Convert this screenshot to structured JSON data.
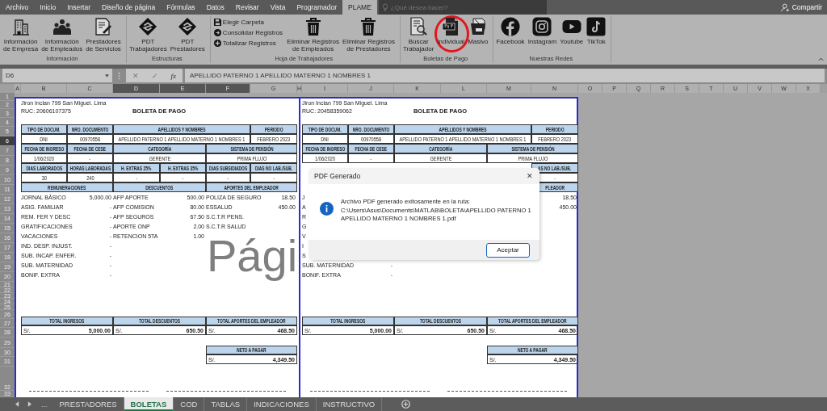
{
  "menu_tabs": [
    {
      "label": "Archivo",
      "selected": false
    },
    {
      "label": "Inicio",
      "selected": false
    },
    {
      "label": "Insertar",
      "selected": false
    },
    {
      "label": "Diseño de página",
      "selected": false
    },
    {
      "label": "Fórmulas",
      "selected": false
    },
    {
      "label": "Datos",
      "selected": false
    },
    {
      "label": "Revisar",
      "selected": false
    },
    {
      "label": "Vista",
      "selected": false
    },
    {
      "label": "Programador",
      "selected": false
    },
    {
      "label": "PLAME",
      "selected": true
    }
  ],
  "search": {
    "placeholder": "¿Qué desea hacer?"
  },
  "share": "Compartir",
  "ribbon_groups": [
    {
      "label": "Información",
      "items": [
        {
          "kind": "large",
          "lines": [
            "Información",
            "de Empresa"
          ]
        },
        {
          "kind": "large",
          "lines": [
            "Información",
            "de Empleados"
          ]
        },
        {
          "kind": "large",
          "lines": [
            "Prestadores",
            "de Servicios"
          ]
        }
      ]
    },
    {
      "label": "Estructuras",
      "items": [
        {
          "kind": "large",
          "lines": [
            "PDT",
            "Trabajadores"
          ]
        },
        {
          "kind": "large",
          "lines": [
            "PDT",
            "Prestadores"
          ]
        }
      ]
    },
    {
      "label": "Hoja de Trabajadores",
      "items": [
        {
          "kind": "stack",
          "entries": [
            "Elegir Carpeta",
            "Consolidar Registros",
            "Totalizar Registros"
          ]
        },
        {
          "kind": "large",
          "lines": [
            "Eliminar Registros",
            "de Empleados"
          ]
        },
        {
          "kind": "large",
          "lines": [
            "Eliminar Registros",
            "de Prestadores"
          ]
        }
      ]
    },
    {
      "label": "Boletas de Pago",
      "items": [
        {
          "kind": "large",
          "lines": [
            "Buscar",
            "Trabajador"
          ],
          "highlighted": false
        },
        {
          "kind": "large",
          "lines": [
            "Individual"
          ],
          "highlighted": true
        },
        {
          "kind": "large",
          "lines": [
            "Masivo"
          ],
          "highlighted": false
        }
      ]
    },
    {
      "label": "Nuestras Redes",
      "items": [
        {
          "kind": "large",
          "lines": [
            "Facebook"
          ]
        },
        {
          "kind": "large",
          "lines": [
            "Instagram"
          ]
        },
        {
          "kind": "large",
          "lines": [
            "Youtube"
          ]
        },
        {
          "kind": "large",
          "lines": [
            "TikTok"
          ]
        }
      ]
    }
  ],
  "formula_bar": {
    "name_box": "D6",
    "cancel": "✕",
    "enter": "✓",
    "fx": "fx",
    "value": "APELLIDO PATERNO 1 APELLIDO MATERNO 1 NOMBRES 1"
  },
  "columns": [
    {
      "label": "A",
      "selected": false
    },
    {
      "label": "B",
      "selected": false
    },
    {
      "label": "C",
      "selected": false
    },
    {
      "label": "D",
      "selected": true
    },
    {
      "label": "E",
      "selected": true
    },
    {
      "label": "F",
      "selected": true
    },
    {
      "label": "G",
      "selected": false
    },
    {
      "label": "H",
      "selected": false
    },
    {
      "label": "I",
      "selected": false
    },
    {
      "label": "J",
      "selected": false
    },
    {
      "label": "K",
      "selected": false
    },
    {
      "label": "L",
      "selected": false
    },
    {
      "label": "M",
      "selected": false
    },
    {
      "label": "N",
      "selected": false
    },
    {
      "label": "O",
      "selected": false
    },
    {
      "label": "P",
      "selected": false
    },
    {
      "label": "Q",
      "selected": false
    },
    {
      "label": "R",
      "selected": false
    },
    {
      "label": "S",
      "selected": false
    },
    {
      "label": "T",
      "selected": false
    },
    {
      "label": "U",
      "selected": false
    },
    {
      "label": "V",
      "selected": false
    },
    {
      "label": "W",
      "selected": false
    },
    {
      "label": "X",
      "selected": false
    }
  ],
  "rows": [
    {
      "label": "1",
      "selected": false
    },
    {
      "label": "2",
      "selected": false
    },
    {
      "label": "3",
      "selected": false
    },
    {
      "label": "4",
      "selected": false
    },
    {
      "label": "5",
      "selected": false
    },
    {
      "label": "6",
      "selected": true
    },
    {
      "label": "7",
      "selected": false
    },
    {
      "label": "8",
      "selected": false
    },
    {
      "label": "9",
      "selected": false
    },
    {
      "label": "10",
      "selected": false
    },
    {
      "label": "11",
      "selected": false
    },
    {
      "label": "12",
      "selected": false
    },
    {
      "label": "13",
      "selected": false
    },
    {
      "label": "14",
      "selected": false
    },
    {
      "label": "15",
      "selected": false
    },
    {
      "label": "16",
      "selected": false
    },
    {
      "label": "17",
      "selected": false
    },
    {
      "label": "18",
      "selected": false
    },
    {
      "label": "19",
      "selected": false
    },
    {
      "label": "20",
      "selected": false
    },
    {
      "label": "21",
      "selected": false
    },
    {
      "label": "22",
      "selected": false
    },
    {
      "label": "23",
      "selected": false
    },
    {
      "label": "24",
      "selected": false
    },
    {
      "label": "25",
      "selected": false
    },
    {
      "label": "26",
      "selected": false
    },
    {
      "label": "27",
      "selected": false
    },
    {
      "label": "28",
      "selected": false
    },
    {
      "label": "29",
      "selected": false
    },
    {
      "label": "30",
      "selected": false
    },
    {
      "label": "31",
      "selected": false
    },
    {
      "label": "32",
      "selected": false
    },
    {
      "label": "33",
      "selected": false
    }
  ],
  "boletas": [
    {
      "address": "Jiron Inclan 799 San Miguel. Lima",
      "ruc": "RUC: 20606107375",
      "title": "BOLETA DE PAGO",
      "table": [
        {
          "kind": "id-head",
          "cells": [
            {
              "text": "TIPO DE DOCUM."
            },
            {
              "text": "NRO. DOCUMENTO"
            },
            {
              "text": "APELLIDOS Y NOMBRES"
            },
            {
              "text": "PERIODO"
            }
          ]
        },
        {
          "kind": "id-value",
          "cells": [
            {
              "text": "DNI"
            },
            {
              "text": "00970558"
            },
            {
              "text": "APELLIDO PATERNO 1 APELLIDO MATERNO 1 NOMBRES 1"
            },
            {
              "text": "FEBRERO 2023"
            }
          ]
        },
        {
          "kind": "date-head",
          "cells": [
            {
              "text": "FECHA DE INGRESO"
            },
            {
              "text": "FECHA DE CESE"
            },
            {
              "text": "CATEGORÍA"
            },
            {
              "text": "SISTEMA DE PENSIÓN"
            }
          ]
        },
        {
          "kind": "date-value",
          "cells": [
            {
              "text": "1/06/2020"
            },
            {
              "text": "-"
            },
            {
              "text": "GERENTE"
            },
            {
              "text": "PRIMA FLUJO"
            }
          ]
        },
        {
          "kind": "count-head",
          "cells": [
            {
              "text": "DIAS LABORADOS"
            },
            {
              "text": "HORAS LABORADAS"
            },
            {
              "text": "H. EXTRAS 25%"
            },
            {
              "text": "H. EXTRAS 35%"
            },
            {
              "text": "DIAS SUBSIDIADOS"
            },
            {
              "text": "DIAS NO LAB./SUB."
            }
          ]
        },
        {
          "kind": "count-value",
          "cells": [
            {
              "text": "30"
            },
            {
              "text": "240"
            },
            {
              "text": "-"
            },
            {
              "text": "-"
            },
            {
              "text": "-"
            },
            {
              "text": "-"
            }
          ]
        },
        {
          "kind": "section-head",
          "cells": [
            {
              "text": "REMUNERACIONES"
            },
            {
              "text": "DESCUENTOS"
            },
            {
              "text": "APORTES DEL EMPLEADOR"
            }
          ]
        }
      ],
      "items": [
        {
          "ingreso": "JORNAL BÁSICO",
          "ingreso_monto": "5,000.00",
          "descuento": "AFP APORTE",
          "descuento_monto": "500.00",
          "aporte": "POLIZA DE SEGURO",
          "aporte_monto": "18.50"
        },
        {
          "ingreso": "ASIG. FAMILIAR",
          "ingreso_monto": "-",
          "descuento": "AFP COMISION",
          "descuento_monto": "80.00",
          "aporte": "ESSALUD",
          "aporte_monto": "450.00"
        },
        {
          "ingreso": "REM. FER Y DESC",
          "ingreso_monto": "-",
          "descuento": "AFP SEGUROS",
          "descuento_monto": "67.50",
          "aporte": "S.C.T.R PENS."
        },
        {
          "ingreso": "GRATIFICACIONES",
          "ingreso_monto": "-",
          "descuento": "APORTE ONP",
          "descuento_monto": "2.00",
          "aporte": "S.C.T.R SALUD"
        },
        {
          "ingreso": "VACACIONES",
          "ingreso_monto": "-",
          "descuento": "RETENCION 5TA",
          "descuento_monto": "1.00"
        },
        {
          "ingreso": "IND. DESP. INJUST.",
          "ingreso_monto": "-"
        },
        {
          "ingreso": "SUB. INCAP. ENFER.",
          "ingreso_monto": "-"
        },
        {
          "ingreso": "SUB. MATERNIDAD",
          "ingreso_monto": "-"
        },
        {
          "ingreso": "BONIF. EXTRA",
          "ingreso_monto": "-"
        }
      ],
      "totals": [
        {
          "head": "TOTAL INGRESOS",
          "currency": "S/.",
          "amount": "5,000.00"
        },
        {
          "head": "TOTAL DESCUENTOS",
          "currency": "S/.",
          "amount": "650.50"
        },
        {
          "head": "TOTAL APORTES DEL EMPLEADOR",
          "currency": "S/.",
          "amount": "468.50"
        }
      ],
      "neto": {
        "head": "NETO A PAGAR",
        "currency": "S/.",
        "amount": "4,349.50"
      }
    },
    {
      "address": "Jiron Inclan 799 San Miguel. Lima",
      "ruc": "RUC: 20458359062",
      "title": "BOLETA DE PAGO",
      "table": [
        {
          "kind": "id-head",
          "cells": [
            {
              "text": "TIPO DE DOCUM."
            },
            {
              "text": "NRO. DOCUMENTO"
            },
            {
              "text": "APELLIDOS Y NOMBRES"
            },
            {
              "text": "PERIODO"
            }
          ]
        },
        {
          "kind": "id-value",
          "cells": [
            {
              "text": "DNI"
            },
            {
              "text": "00970558"
            },
            {
              "text": "APELLIDO PATERNO 1 APELLIDO MATERNO 1 NOMBRES 1"
            },
            {
              "text": "FEBRERO 2023"
            }
          ]
        },
        {
          "kind": "date-head",
          "cells": [
            {
              "text": "FECHA DE INGRESO"
            },
            {
              "text": "FECHA DE CESE"
            },
            {
              "text": "CATEGORÍA"
            },
            {
              "text": "SISTEMA DE PENSIÓN"
            }
          ]
        },
        {
          "kind": "date-value",
          "cells": [
            {
              "text": "1/06/2020"
            },
            {
              "text": "-"
            },
            {
              "text": "GERENTE"
            },
            {
              "text": "PRIMA FLUJO"
            }
          ]
        },
        {
          "kind": "count-head",
          "cells": [
            {},
            {},
            {},
            {},
            {},
            {
              "text": "AS NO LAB./SUB."
            }
          ]
        },
        {
          "kind": "count-value",
          "cells": [
            {},
            {},
            {},
            {},
            {},
            {
              "text": "-"
            }
          ]
        },
        {
          "kind": "count-head",
          "cells": [
            {},
            {},
            {},
            {},
            {},
            {
              "text": "PLEADOR"
            }
          ]
        }
      ],
      "items": [
        {
          "ingreso": "J",
          "aporte_monto": "18.50"
        },
        {
          "ingreso": "A",
          "aporte_monto": "450.00"
        },
        {
          "ingreso": "R"
        },
        {
          "ingreso": "G"
        },
        {
          "ingreso": "V"
        },
        {
          "ingreso": "I"
        },
        {
          "ingreso": "S"
        },
        {
          "ingreso": "SUB. MATERNIDAD",
          "ingreso_monto": "-"
        },
        {
          "ingreso": "BONIF. EXTRA",
          "ingreso_monto": "-"
        }
      ],
      "totals": [
        {
          "head": "TOTAL INGRESOS",
          "currency": "S/.",
          "amount": "5,000.00"
        },
        {
          "head": "TOTAL DESCUENTOS",
          "currency": "S/.",
          "amount": "650.50"
        },
        {
          "head": "TOTAL APORTES DEL EMPLEADOR",
          "currency": "S/.",
          "amount": "468.50"
        }
      ],
      "neto": {
        "head": "NETO A PAGAR",
        "currency": "S/.",
        "amount": "4,349.50"
      }
    }
  ],
  "page_label": "Pági",
  "sheet_tabs": {
    "more": "...",
    "tabs": [
      {
        "label": "PRESTADORES",
        "selected": false
      },
      {
        "label": "BOLETAS",
        "selected": true
      },
      {
        "label": "COD",
        "selected": false
      },
      {
        "label": "TABLAS",
        "selected": false
      },
      {
        "label": "INDICACIONES",
        "selected": false
      },
      {
        "label": "INSTRUCTIVO",
        "selected": false
      }
    ]
  },
  "dialog": {
    "title": "PDF Generado",
    "close": "✕",
    "message": "Archivo PDF generado exitosamente en la ruta:\nC:\\Users\\Asus\\Documents\\MATLAB\\BOLETA\\APELLIDO PATERNO 1\nAPELLIDO MATERNO 1 NOMBRES 1.pdf",
    "button": "Aceptar"
  }
}
